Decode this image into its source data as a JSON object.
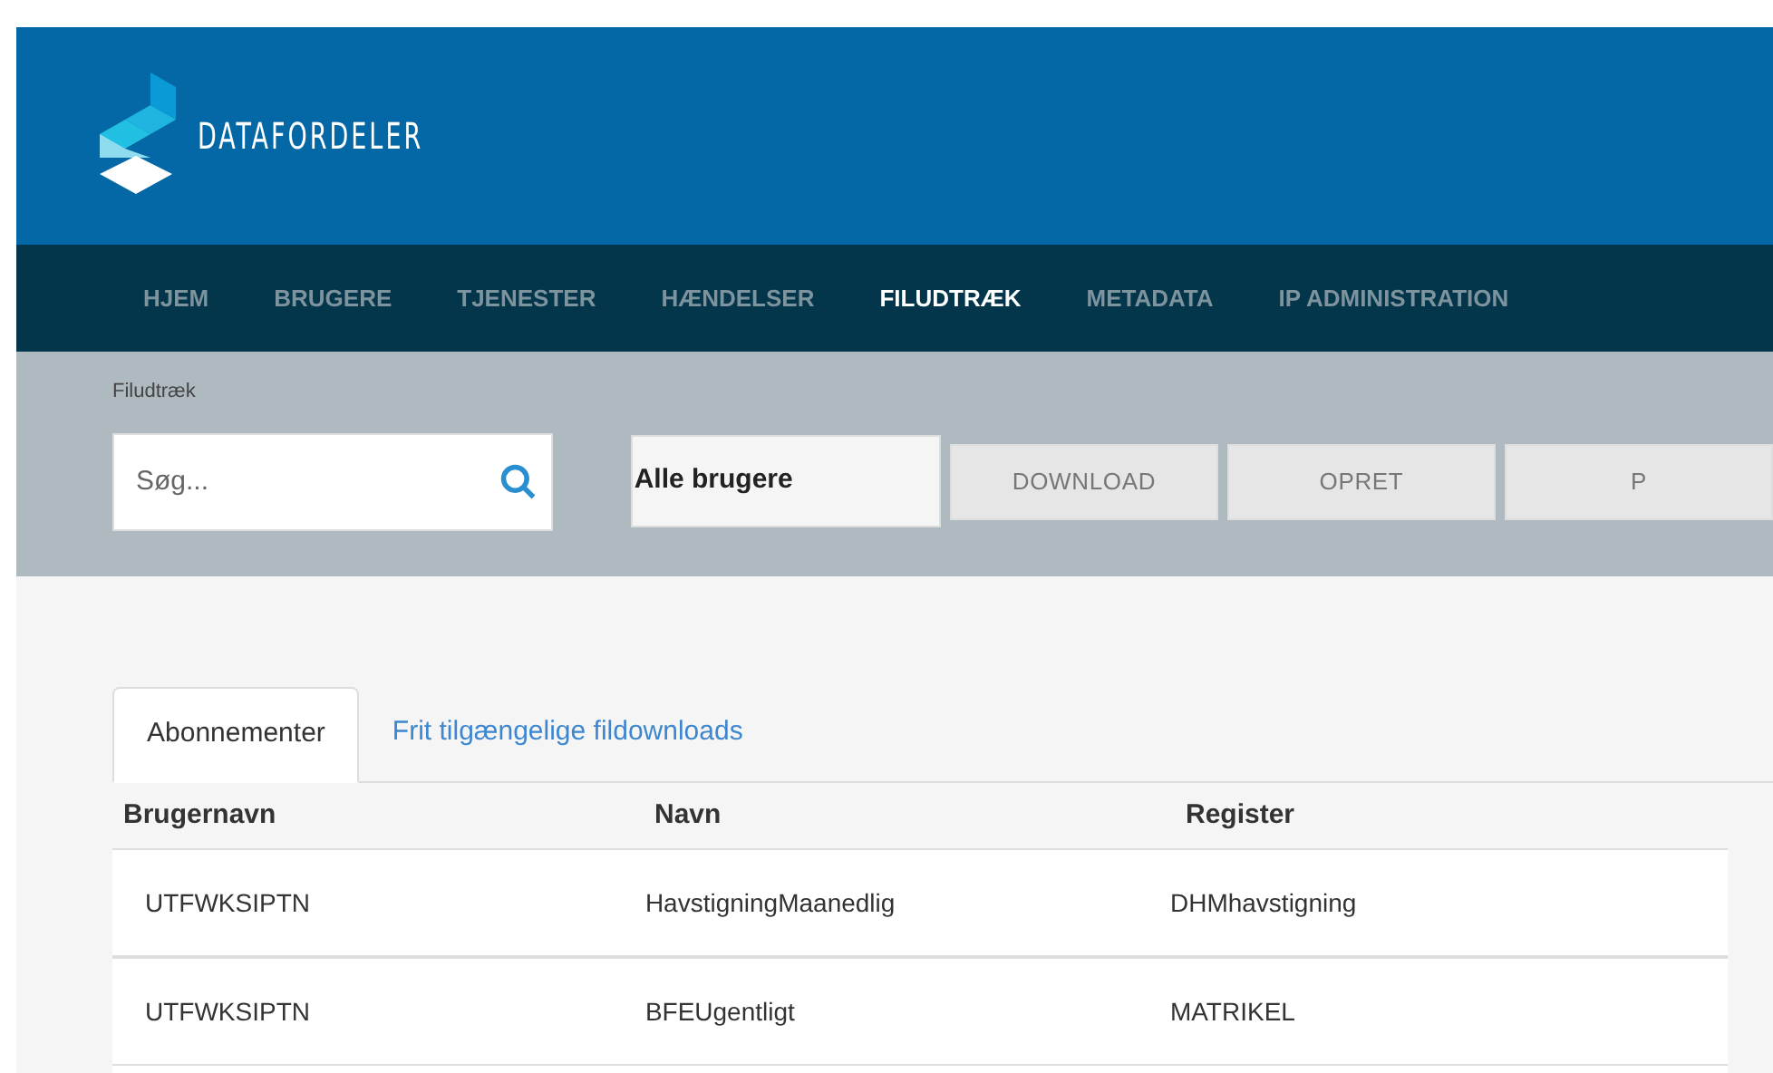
{
  "logo": {
    "text": "DATAFORDELER"
  },
  "nav": [
    {
      "label": "HJEM",
      "selected": false
    },
    {
      "label": "BRUGERE",
      "selected": false
    },
    {
      "label": "TJENESTER",
      "selected": false
    },
    {
      "label": "HÆNDELSER",
      "selected": false
    },
    {
      "label": "FILUDTRÆK",
      "selected": true
    },
    {
      "label": "METADATA",
      "selected": false
    },
    {
      "label": "IP ADMINISTRATION",
      "selected": false
    }
  ],
  "breadcrumb": "Filudtræk",
  "search": {
    "placeholder": "Søg..."
  },
  "user_filter": {
    "value": "Alle brugere"
  },
  "buttons": [
    "DOWNLOAD",
    "OPRET",
    "P"
  ],
  "tabs": [
    {
      "label": "Abonnementer",
      "selected": true
    },
    {
      "label": "Frit tilgængelige fildownloads",
      "selected": false
    }
  ],
  "table": {
    "columns": [
      "Brugernavn",
      "Navn",
      "Register"
    ],
    "rows": [
      [
        "UTFWKSIPTN",
        "HavstigningMaanedlig",
        "DHMhavstigning"
      ],
      [
        "UTFWKSIPTN",
        "BFEUgentligt",
        "MATRIKEL"
      ]
    ]
  }
}
